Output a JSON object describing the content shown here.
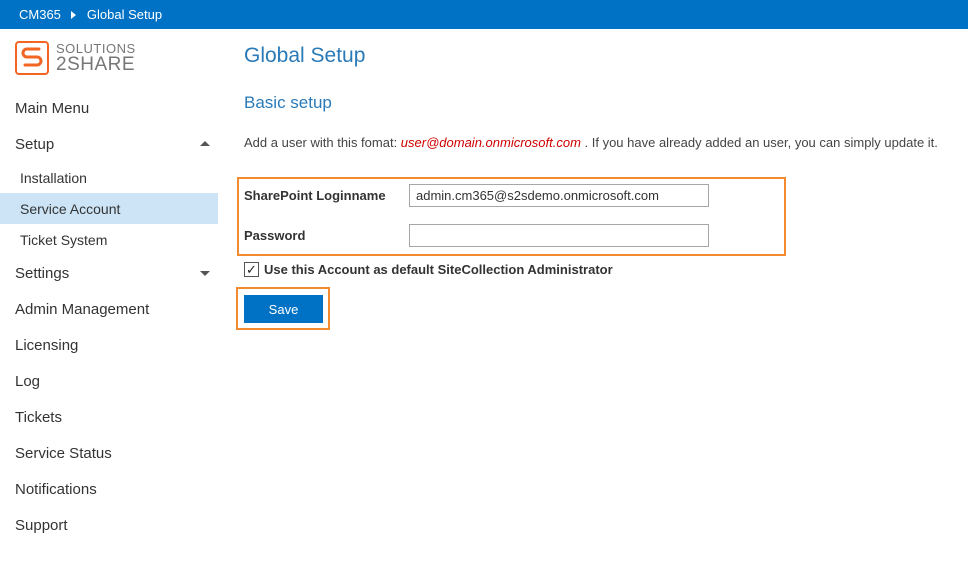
{
  "breadcrumb": {
    "app": "CM365",
    "page": "Global Setup"
  },
  "logo": {
    "line1": "SOLUTIONS",
    "line2": "2SHARE",
    "color": "#f26522"
  },
  "sidebar": {
    "items": [
      {
        "label": "Main Menu"
      },
      {
        "label": "Setup"
      },
      {
        "label": "Installation"
      },
      {
        "label": "Service Account"
      },
      {
        "label": "Ticket System"
      },
      {
        "label": "Settings"
      },
      {
        "label": "Admin Management"
      },
      {
        "label": "Licensing"
      },
      {
        "label": "Log"
      },
      {
        "label": "Tickets"
      },
      {
        "label": "Service Status"
      },
      {
        "label": "Notifications"
      },
      {
        "label": "Support"
      }
    ]
  },
  "main": {
    "title": "Global Setup",
    "section_title": "Basic setup",
    "info_prefix": "Add a user with this fomat: ",
    "info_email": "user@domain.onmicrosoft.com",
    "info_suffix": " . If you have already added an user, you can simply update it.",
    "login_label": "SharePoint Loginname",
    "login_value": "admin.cm365@s2sdemo.onmicrosoft.com",
    "password_label": "Password",
    "password_value": "",
    "checkbox_label": "Use this Account as default SiteCollection Administrator",
    "checkbox_checked": true,
    "save_label": "Save"
  },
  "colors": {
    "accent": "#0072c6",
    "highlight": "#f28a30",
    "title": "#2a7ab8",
    "active_nav": "#cce4f6"
  }
}
